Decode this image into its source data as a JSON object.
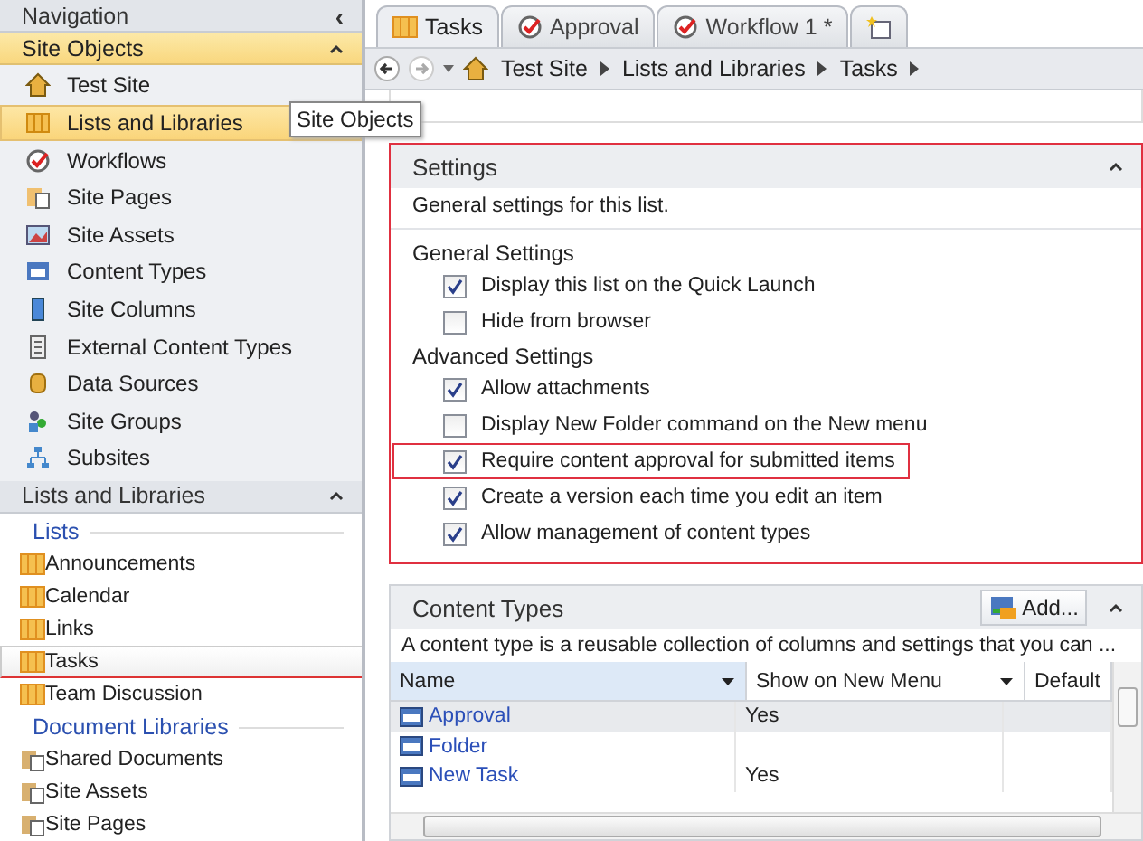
{
  "navigation": {
    "title": "Navigation",
    "collapse": "‹"
  },
  "site_objects": {
    "title": "Site Objects",
    "items": [
      {
        "label": "Test Site",
        "selected": false
      },
      {
        "label": "Lists and Libraries",
        "selected": true
      },
      {
        "label": "Workflows",
        "selected": false
      },
      {
        "label": "Site Pages",
        "selected": false
      },
      {
        "label": "Site Assets",
        "selected": false
      },
      {
        "label": "Content Types",
        "selected": false
      },
      {
        "label": "Site Columns",
        "selected": false
      },
      {
        "label": "External Content Types",
        "selected": false
      },
      {
        "label": "Data Sources",
        "selected": false
      },
      {
        "label": "Site Groups",
        "selected": false
      },
      {
        "label": "Subsites",
        "selected": false
      }
    ]
  },
  "tooltip": "Site Objects",
  "lists_and_libraries": {
    "title": "Lists and Libraries",
    "groups": [
      {
        "title": "Lists",
        "kind": "list",
        "items": [
          {
            "label": "Announcements",
            "selected": false
          },
          {
            "label": "Calendar",
            "selected": false
          },
          {
            "label": "Links",
            "selected": false
          },
          {
            "label": "Tasks",
            "selected": true
          },
          {
            "label": "Team Discussion",
            "selected": false
          }
        ]
      },
      {
        "title": "Document Libraries",
        "kind": "library",
        "items": [
          {
            "label": "Shared Documents",
            "selected": false
          },
          {
            "label": "Site Assets",
            "selected": false
          },
          {
            "label": "Site Pages",
            "selected": false
          }
        ]
      }
    ]
  },
  "tabs": [
    {
      "label": "Tasks",
      "kind": "list",
      "selected": true
    },
    {
      "label": "Approval",
      "kind": "workflow",
      "selected": false
    },
    {
      "label": "Workflow 1 *",
      "kind": "workflow",
      "selected": false
    },
    {
      "kind": "new",
      "selected": false
    }
  ],
  "breadcrumb": [
    "Test Site",
    "Lists and Libraries",
    "Tasks"
  ],
  "settings": {
    "title": "Settings",
    "highlighted": true,
    "description": "General settings for this list.",
    "sections": [
      {
        "title": "General Settings",
        "options": [
          {
            "label": "Display this list on the Quick Launch",
            "checked": true,
            "highlighted": false
          },
          {
            "label": "Hide from browser",
            "checked": false,
            "highlighted": false
          }
        ]
      },
      {
        "title": "Advanced Settings",
        "options": [
          {
            "label": "Allow attachments",
            "checked": true,
            "highlighted": false
          },
          {
            "label": "Display New Folder command on the New menu",
            "checked": false,
            "highlighted": false
          },
          {
            "label": "Require content approval for submitted items",
            "checked": true,
            "highlighted": true
          },
          {
            "label": "Create a version each time you edit an item",
            "checked": true,
            "highlighted": false
          },
          {
            "label": "Allow management of content types",
            "checked": true,
            "highlighted": false
          }
        ]
      }
    ]
  },
  "content_types": {
    "title": "Content Types",
    "add_button": "Add...",
    "description": "A content type is a reusable collection of columns and settings that you can ...",
    "columns": [
      "Name",
      "Show on New Menu",
      "Default"
    ],
    "rows": [
      {
        "name": "Approval",
        "show_on_new_menu": "Yes",
        "selected": true
      },
      {
        "name": "Folder",
        "selected": false
      },
      {
        "name": "New Task",
        "show_on_new_menu": "Yes",
        "selected": false
      }
    ]
  }
}
